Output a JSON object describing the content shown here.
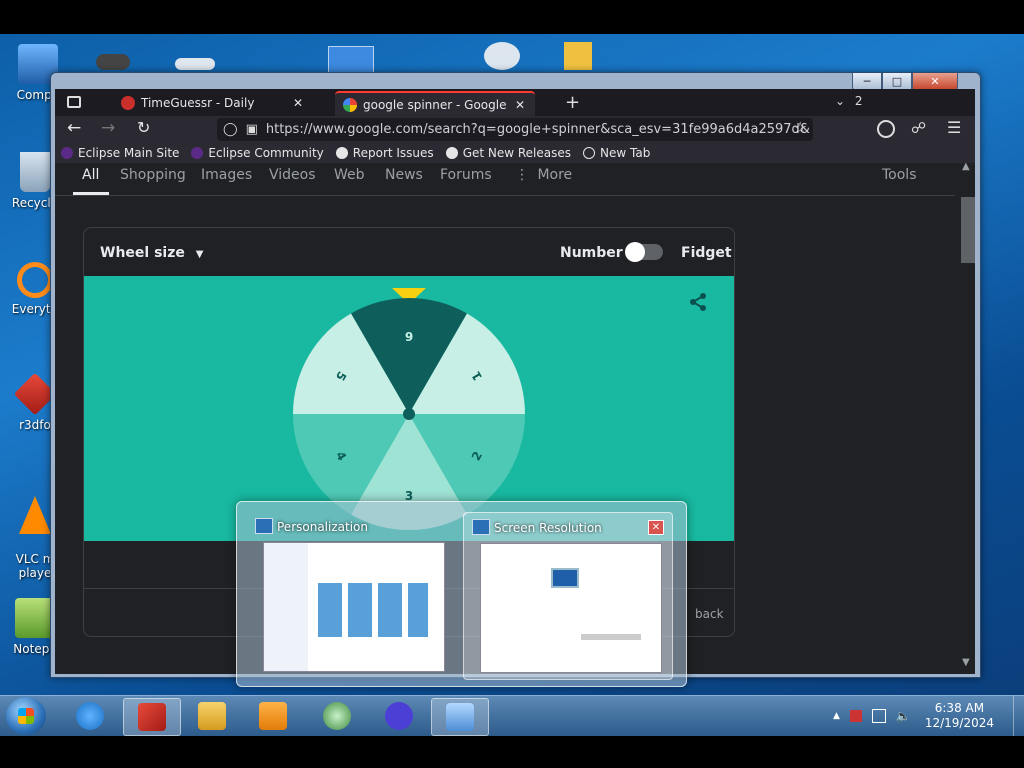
{
  "desktop": {
    "icons": [
      {
        "label": "Compu"
      },
      {
        "label": "Recycle"
      },
      {
        "label": "Everyth"
      },
      {
        "label": "r3dfo"
      },
      {
        "label": "VLC m\nplaye"
      },
      {
        "label": "Notepa"
      }
    ]
  },
  "browser": {
    "tabs": [
      {
        "label": "TimeGuessr - Daily"
      },
      {
        "label": "google spinner - Google Sea"
      }
    ],
    "tab_count": "2",
    "url": "https://www.google.com/search?q=google+spinner&sca_esv=31fe99a6d4a2597d&",
    "bookmarks": [
      {
        "label": "Eclipse Main Site"
      },
      {
        "label": "Eclipse Community"
      },
      {
        "label": "Report Issues"
      },
      {
        "label": "Get New Releases"
      },
      {
        "label": "New Tab"
      }
    ]
  },
  "search": {
    "tabs": [
      {
        "label": "All"
      },
      {
        "label": "Shopping"
      },
      {
        "label": "Images"
      },
      {
        "label": "Videos"
      },
      {
        "label": "Web"
      },
      {
        "label": "News"
      },
      {
        "label": "Forums"
      },
      {
        "label": "More"
      }
    ],
    "tools_label": "Tools"
  },
  "spinner": {
    "wheel_size_label": "Wheel size",
    "number_label": "Number",
    "fidget_label": "Fidget",
    "segments": [
      "6",
      "1",
      "2",
      "3",
      "4",
      "5"
    ],
    "feedback_fragment": "back"
  },
  "preview": {
    "windows": [
      {
        "title": "Personalization"
      },
      {
        "title": "Screen Resolution"
      }
    ]
  },
  "taskbar": {
    "time": "6:38 AM",
    "date": "12/19/2024"
  }
}
